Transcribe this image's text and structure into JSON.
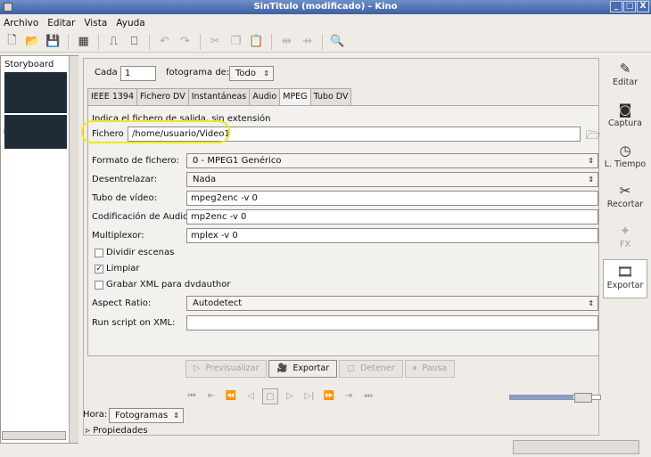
{
  "window": {
    "title": "SinTitulo (modificado) - Kino",
    "buttons": [
      "_",
      "□",
      "X"
    ]
  },
  "menu": [
    "Archivo",
    "Editar",
    "Vista",
    "Ayuda"
  ],
  "toolbar": {
    "icons": [
      "new-icon",
      "open-icon",
      "save-icon",
      "properties-icon",
      "film-insert-icon",
      "film-append-icon",
      "undo-icon",
      "redo-icon",
      "cut-icon",
      "copy-icon",
      "paste-icon",
      "split-icon",
      "join-icon",
      "zoom-icon"
    ]
  },
  "storyboard": {
    "title": "Storyboard"
  },
  "top": {
    "cada_label": "Cada",
    "cada_value": "1",
    "fotograma_label": "fotograma de:",
    "fotograma_value": "Todo"
  },
  "tabs": [
    "IEEE 1394",
    "Fichero DV",
    "Instantáneas",
    "Audio",
    "MPEG",
    "Tubo DV"
  ],
  "export": {
    "hint": "Indica el fichero de salida, sin extensión",
    "fichero_label": "Fichero",
    "fichero_value": "/home/usuario/Video1",
    "formato_label": "Formato de fichero:",
    "formato_value": "0 - MPEG1 Genérico",
    "desent_label": "Desentrelazar:",
    "desent_value": "Nada",
    "tubo_label": "Tubo de vídeo:",
    "tubo_value": "mpeg2enc -v 0",
    "codif_label": "Codificación de Audio:",
    "codif_value": "mp2enc -v 0",
    "mult_label": "Multiplexor:",
    "mult_value": "mplex -v 0",
    "dividir_label": "Dividir escenas",
    "limpiar_label": "Limpiar",
    "grabar_label": "Grabar XML para dvdauthor",
    "aspect_label": "Aspect Ratio:",
    "aspect_value": "Autodetect",
    "script_label": "Run script on XML:",
    "script_value": ""
  },
  "actions": {
    "preview": "Previsualizar",
    "export": "Exportar",
    "stop": "Detener",
    "pause": "Pausa"
  },
  "hora": {
    "label": "Hora:",
    "value": "Fotogramas",
    "propiedades": "Propiedades"
  },
  "sidebar": [
    {
      "label": "Editar",
      "icon": "edit-icon"
    },
    {
      "label": "Captura",
      "icon": "capture-icon"
    },
    {
      "label": "L. Tiempo",
      "icon": "timeline-icon"
    },
    {
      "label": "Recortar",
      "icon": "trim-icon"
    },
    {
      "label": "FX",
      "icon": "fx-icon"
    },
    {
      "label": "Exportar",
      "icon": "export-icon"
    }
  ]
}
